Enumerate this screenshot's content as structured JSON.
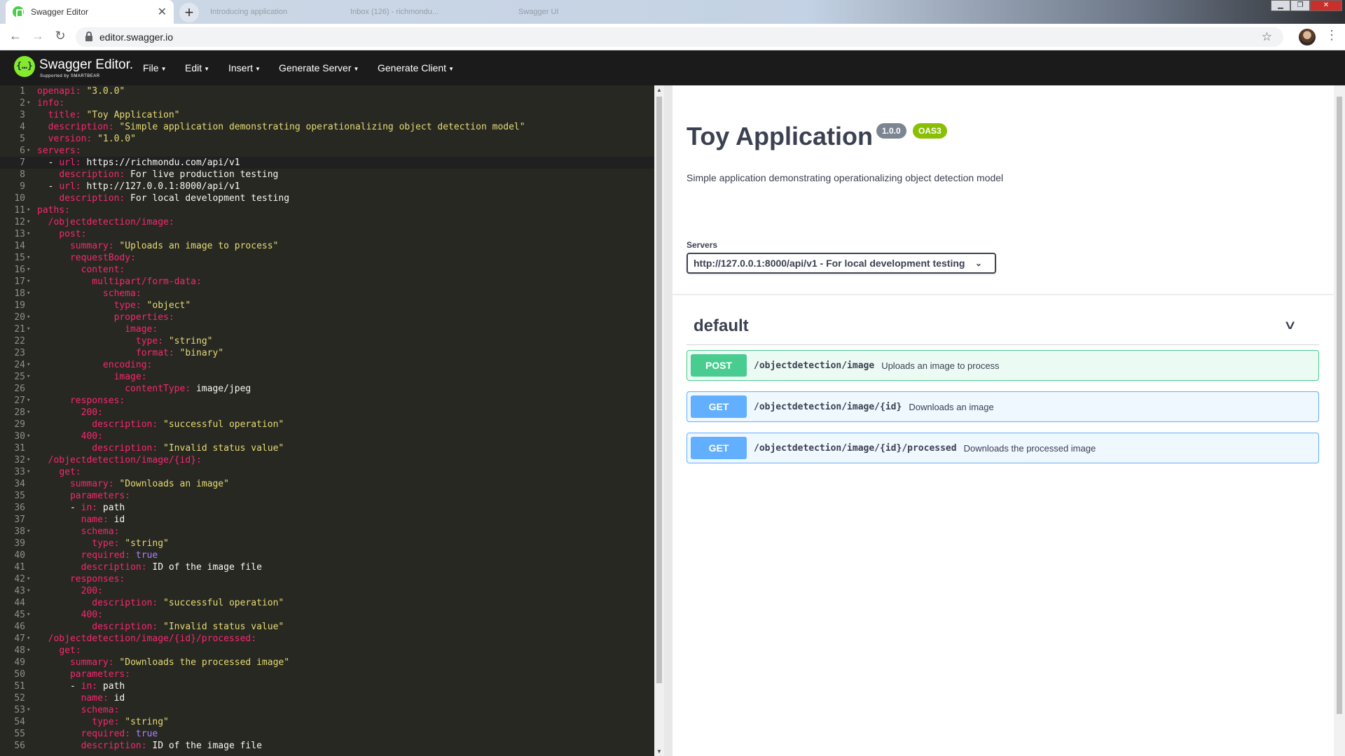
{
  "browser": {
    "active_tab": "Swagger Editor",
    "other_tabs": [
      "Introducing application",
      "Inbox (126) - richmondu...",
      "Swagger UI"
    ],
    "url": "editor.swagger.io"
  },
  "topbar": {
    "brand": "Swagger Editor.",
    "brand_sub": "Supported by SMARTBEAR",
    "menus": [
      "File",
      "Edit",
      "Insert",
      "Generate Server",
      "Generate Client"
    ]
  },
  "editor": {
    "lines": [
      {
        "n": "1",
        "t": "openapi: \"3.0.0\""
      },
      {
        "n": "2",
        "t": "info:"
      },
      {
        "n": "3",
        "t": "  title: \"Toy Application\""
      },
      {
        "n": "4",
        "t": "  description: \"Simple application demonstrating operationalizing object detection model\""
      },
      {
        "n": "5",
        "t": "  version: \"1.0.0\""
      },
      {
        "n": "6",
        "t": "servers:"
      },
      {
        "n": "7",
        "t": "  - url: https://richmondu.com/api/v1"
      },
      {
        "n": "8",
        "t": "    description: For live production testing"
      },
      {
        "n": "9",
        "t": "  - url: http://127.0.0.1:8000/api/v1"
      },
      {
        "n": "10",
        "t": "    description: For local development testing"
      },
      {
        "n": "11",
        "t": "paths:"
      },
      {
        "n": "12",
        "t": "  /objectdetection/image:"
      },
      {
        "n": "13",
        "t": "    post:"
      },
      {
        "n": "14",
        "t": "      summary: \"Uploads an image to process\""
      },
      {
        "n": "15",
        "t": "      requestBody:"
      },
      {
        "n": "16",
        "t": "        content:"
      },
      {
        "n": "17",
        "t": "          multipart/form-data:"
      },
      {
        "n": "18",
        "t": "            schema:"
      },
      {
        "n": "19",
        "t": "              type: \"object\""
      },
      {
        "n": "20",
        "t": "              properties:"
      },
      {
        "n": "21",
        "t": "                image:"
      },
      {
        "n": "22",
        "t": "                  type: \"string\""
      },
      {
        "n": "23",
        "t": "                  format: \"binary\""
      },
      {
        "n": "24",
        "t": "            encoding:"
      },
      {
        "n": "25",
        "t": "              image:"
      },
      {
        "n": "26",
        "t": "                contentType: image/jpeg"
      },
      {
        "n": "27",
        "t": "      responses:"
      },
      {
        "n": "28",
        "t": "        200:"
      },
      {
        "n": "29",
        "t": "          description: \"successful operation\""
      },
      {
        "n": "30",
        "t": "        400:"
      },
      {
        "n": "31",
        "t": "          description: \"Invalid status value\""
      },
      {
        "n": "32",
        "t": "  /objectdetection/image/{id}:"
      },
      {
        "n": "33",
        "t": "    get:"
      },
      {
        "n": "34",
        "t": "      summary: \"Downloads an image\""
      },
      {
        "n": "35",
        "t": "      parameters:"
      },
      {
        "n": "36",
        "t": "      - in: path"
      },
      {
        "n": "37",
        "t": "        name: id"
      },
      {
        "n": "38",
        "t": "        schema:"
      },
      {
        "n": "39",
        "t": "          type: \"string\""
      },
      {
        "n": "40",
        "t": "        required: true"
      },
      {
        "n": "41",
        "t": "        description: ID of the image file"
      },
      {
        "n": "42",
        "t": "      responses:"
      },
      {
        "n": "43",
        "t": "        200:"
      },
      {
        "n": "44",
        "t": "          description: \"successful operation\""
      },
      {
        "n": "45",
        "t": "        400:"
      },
      {
        "n": "46",
        "t": "          description: \"Invalid status value\""
      },
      {
        "n": "47",
        "t": "  /objectdetection/image/{id}/processed:"
      },
      {
        "n": "48",
        "t": "    get:"
      },
      {
        "n": "49",
        "t": "      summary: \"Downloads the processed image\""
      },
      {
        "n": "50",
        "t": "      parameters:"
      },
      {
        "n": "51",
        "t": "      - in: path"
      },
      {
        "n": "52",
        "t": "        name: id"
      },
      {
        "n": "53",
        "t": "        schema:"
      },
      {
        "n": "54",
        "t": "          type: \"string\""
      },
      {
        "n": "55",
        "t": "        required: true"
      },
      {
        "n": "56",
        "t": "        description: ID of the image file"
      }
    ],
    "active_line": "7"
  },
  "preview": {
    "title": "Toy Application",
    "version": "1.0.0",
    "oas": "OAS3",
    "description": "Simple application demonstrating operationalizing object detection model",
    "servers_label": "Servers",
    "selected_server": "http://127.0.0.1:8000/api/v1 - For local development testing",
    "tag": "default",
    "operations": [
      {
        "method": "POST",
        "path": "/objectdetection/image",
        "summary": "Uploads an image to process"
      },
      {
        "method": "GET",
        "path": "/objectdetection/image/{id}",
        "summary": "Downloads an image"
      },
      {
        "method": "GET",
        "path": "/objectdetection/image/{id}/processed",
        "summary": "Downloads the processed image"
      }
    ]
  },
  "colors": {
    "post": "#49cc90",
    "get": "#61affe",
    "editor_bg": "#272822",
    "key": "#f92672",
    "string": "#e6db74",
    "number": "#ae81ff"
  },
  "icons": {
    "back": "arrow-left-icon",
    "forward": "arrow-right-icon",
    "reload": "reload-icon",
    "lock": "lock-icon",
    "star": "star-icon",
    "menu": "kebab-menu-icon",
    "collapse": "chevron-down-icon"
  }
}
